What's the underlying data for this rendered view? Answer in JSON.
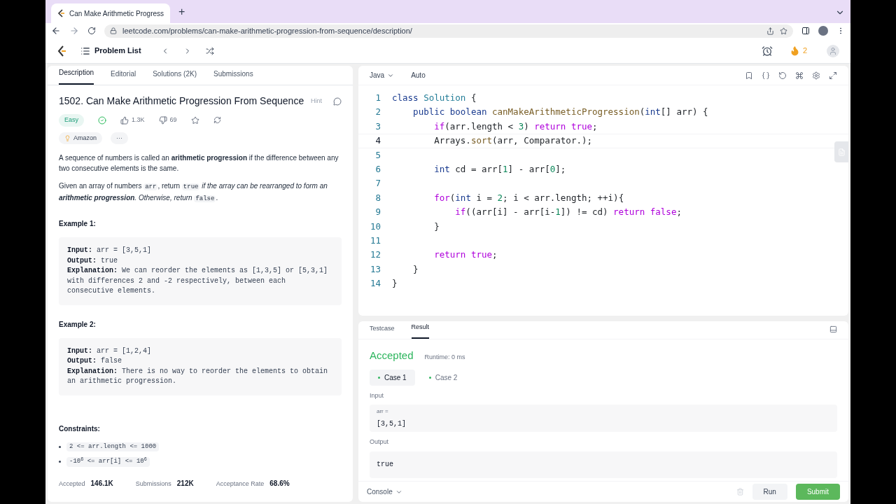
{
  "browser": {
    "tab_title": "Can Make Arithmetic Progress",
    "new_tab": "+",
    "url": "leetcode.com/problems/can-make-arithmetic-progression-from-sequence/description/"
  },
  "nav": {
    "problem_list": "Problem List",
    "streak": "2"
  },
  "left_tabs": [
    {
      "label": "Description",
      "selected": true
    },
    {
      "label": "Editorial",
      "selected": false
    },
    {
      "label": "Solutions (2K)",
      "selected": false
    },
    {
      "label": "Submissions",
      "selected": false
    }
  ],
  "problem": {
    "title": "1502. Can Make Arithmetic Progression From Sequence",
    "hint": "Hint",
    "difficulty": "Easy",
    "solved": true,
    "likes": "1.3K",
    "dislikes": "69",
    "company": "Amazon",
    "more": "···",
    "paragraphs": [
      [
        {
          "text": "A sequence of numbers is called an **arithmetic progression** if the difference between any two consecutive elements is the same.",
          "kind": "text"
        }
      ],
      [
        {
          "text": "Given an array of numbers ",
          "kind": "text"
        },
        {
          "text": "arr",
          "kind": "code"
        },
        {
          "text": ", return ",
          "kind": "text"
        },
        {
          "text": "true",
          "kind": "code"
        },
        {
          "text": " if the array can be rearranged to form an **arithmetic progression**. Otherwise, return ",
          "kind": "italic"
        },
        {
          "text": "false",
          "kind": "code"
        },
        {
          "text": ".",
          "kind": "text"
        }
      ]
    ],
    "examples": [
      {
        "heading": "Example 1:",
        "lines": [
          {
            "label": "Input:",
            "text": "arr = [3,5,1]"
          },
          {
            "label": "Output:",
            "text": "true"
          },
          {
            "label": "Explanation:",
            "text": "We can reorder the elements as [1,3,5] or [5,3,1] with differences 2 and -2 respectively, between each consecutive elements."
          }
        ]
      },
      {
        "heading": "Example 2:",
        "lines": [
          {
            "label": "Input:",
            "text": "arr = [1,2,4]"
          },
          {
            "label": "Output:",
            "text": "false"
          },
          {
            "label": "Explanation:",
            "text": "There is no way to reorder the elements to obtain an arithmetic progression."
          }
        ]
      }
    ],
    "constraints_heading": "Constraints:",
    "constraints": [
      "2 <= arr.length <= 1000",
      "-10$^{6}$ <= arr[i] <= 10$^{6}$"
    ],
    "stats": [
      {
        "label": "Accepted",
        "value": "146.1K"
      },
      {
        "label": "Submissions",
        "value": "212K"
      },
      {
        "label": "Acceptance Rate",
        "value": "68.6%"
      }
    ]
  },
  "editor": {
    "language": "Java",
    "mode": "Auto",
    "lines": [
      {
        "number": "1",
        "current": false,
        "tokens": [
          {
            "text": "class ",
            "kind": "decl"
          },
          {
            "text": "Solution",
            "kind": "type"
          },
          {
            "text": " {",
            "kind": "plain"
          }
        ]
      },
      {
        "number": "2",
        "current": false,
        "tokens": [
          {
            "text": "    public boolean ",
            "kind": "decl"
          },
          {
            "text": "canMakeArithmeticProgression",
            "kind": "func"
          },
          {
            "text": "(",
            "kind": "plain"
          },
          {
            "text": "int",
            "kind": "decl"
          },
          {
            "text": "[] arr) {",
            "kind": "plain"
          }
        ]
      },
      {
        "number": "3",
        "current": false,
        "tokens": [
          {
            "text": "        if",
            "kind": "ctrl"
          },
          {
            "text": "(arr.length < ",
            "kind": "plain"
          },
          {
            "text": "3",
            "kind": "num"
          },
          {
            "text": ") ",
            "kind": "plain"
          },
          {
            "text": "return true",
            "kind": "ctrl"
          },
          {
            "text": ";",
            "kind": "plain"
          }
        ]
      },
      {
        "number": "4",
        "current": true,
        "tokens": [
          {
            "text": "        Arrays.",
            "kind": "plain"
          },
          {
            "text": "sort",
            "kind": "func"
          },
          {
            "text": "(arr, Comparator.);",
            "kind": "plain"
          }
        ]
      },
      {
        "number": "5",
        "current": false
      },
      {
        "number": "6",
        "current": false,
        "tokens": [
          {
            "text": "        int",
            "kind": "decl"
          },
          {
            "text": " cd = arr[",
            "kind": "plain"
          },
          {
            "text": "1",
            "kind": "num"
          },
          {
            "text": "] - arr[",
            "kind": "plain"
          },
          {
            "text": "0",
            "kind": "num"
          },
          {
            "text": "];",
            "kind": "plain"
          }
        ]
      },
      {
        "number": "7",
        "current": false
      },
      {
        "number": "8",
        "current": false,
        "tokens": [
          {
            "text": "        for",
            "kind": "ctrl"
          },
          {
            "text": "(",
            "kind": "plain"
          },
          {
            "text": "int",
            "kind": "decl"
          },
          {
            "text": " i = ",
            "kind": "plain"
          },
          {
            "text": "2",
            "kind": "num"
          },
          {
            "text": "; i < arr.length; ++i){",
            "kind": "plain"
          }
        ]
      },
      {
        "number": "9",
        "current": false,
        "tokens": [
          {
            "text": "            if",
            "kind": "ctrl"
          },
          {
            "text": "((arr[i] - arr[i-",
            "kind": "plain"
          },
          {
            "text": "1",
            "kind": "num"
          },
          {
            "text": "]) != cd) ",
            "kind": "plain"
          },
          {
            "text": "return false",
            "kind": "ctrl"
          },
          {
            "text": ";",
            "kind": "plain"
          }
        ]
      },
      {
        "number": "10",
        "current": false,
        "tokens": [
          {
            "text": "        }",
            "kind": "plain"
          }
        ]
      },
      {
        "number": "11",
        "current": false
      },
      {
        "number": "12",
        "current": false,
        "tokens": [
          {
            "text": "        return true",
            "kind": "ctrl"
          },
          {
            "text": ";",
            "kind": "plain"
          }
        ]
      },
      {
        "number": "13",
        "current": false,
        "tokens": [
          {
            "text": "    }",
            "kind": "plain"
          }
        ]
      },
      {
        "number": "14",
        "current": false,
        "tokens": [
          {
            "text": "}",
            "kind": "plain"
          }
        ]
      }
    ]
  },
  "result_tabs": [
    {
      "label": "Testcase",
      "selected": false
    },
    {
      "label": "Result",
      "selected": true
    }
  ],
  "result": {
    "status": "Accepted",
    "runtime": "Runtime: 0 ms",
    "cases": [
      {
        "label": "Case 1",
        "selected": true
      },
      {
        "label": "Case 2",
        "selected": false
      }
    ],
    "input_label": "Input",
    "input_name": "arr =",
    "input_value": "[3,5,1]",
    "output_label": "Output",
    "output_value": "true"
  },
  "footer": {
    "console": "Console",
    "run": "Run",
    "submit": "Submit"
  }
}
